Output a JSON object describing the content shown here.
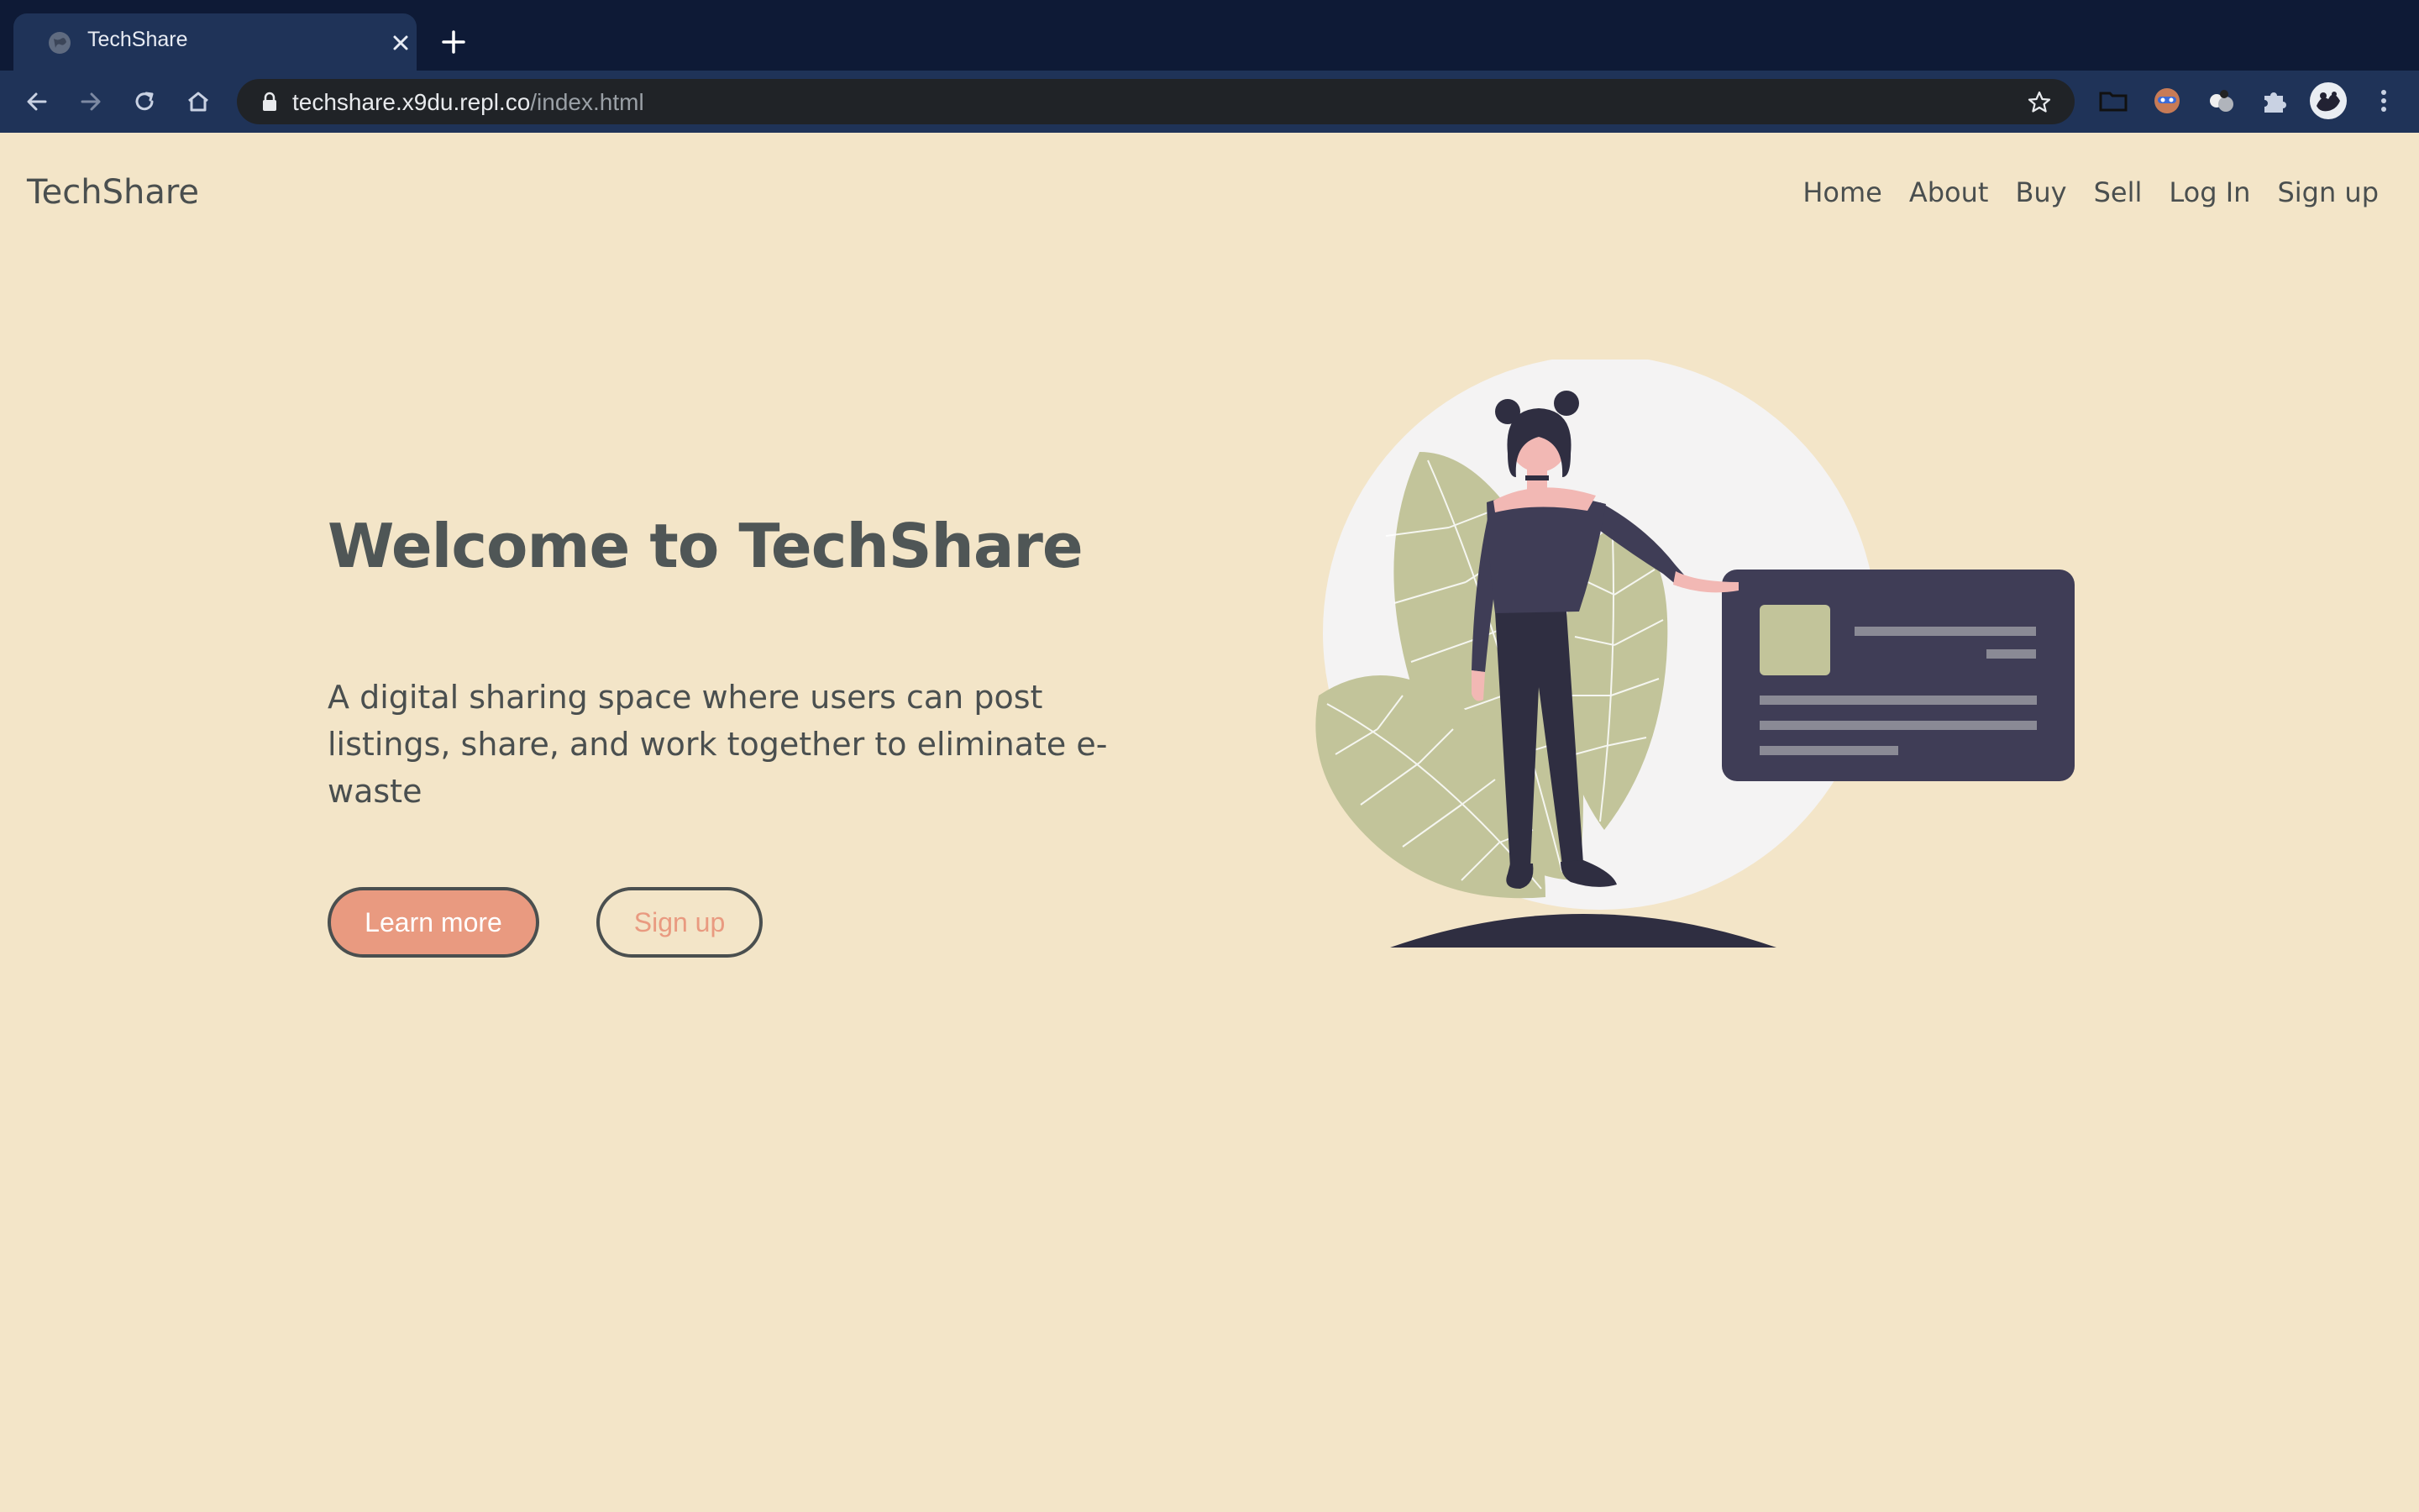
{
  "browser": {
    "tab_title": "TechShare",
    "url_host": "techshare.x9du.repl.co",
    "url_path": "/index.html"
  },
  "site": {
    "brand": "TechShare",
    "nav": [
      "Home",
      "About",
      "Buy",
      "Sell",
      "Log In",
      "Sign up"
    ]
  },
  "hero": {
    "title": "Welcome to TechShare",
    "description": "A digital sharing space where users can post listings, share, and work together to eliminate e-waste",
    "primary_button": "Learn more",
    "secondary_button": "Sign up"
  },
  "colors": {
    "background": "#f3e5c8",
    "accent": "#e99a80",
    "text": "#4a4f4f",
    "chrome_dark": "#0e1a36",
    "chrome_toolbar": "#1f3358",
    "leaf": "#c2c49a",
    "card": "#3f3d56"
  }
}
